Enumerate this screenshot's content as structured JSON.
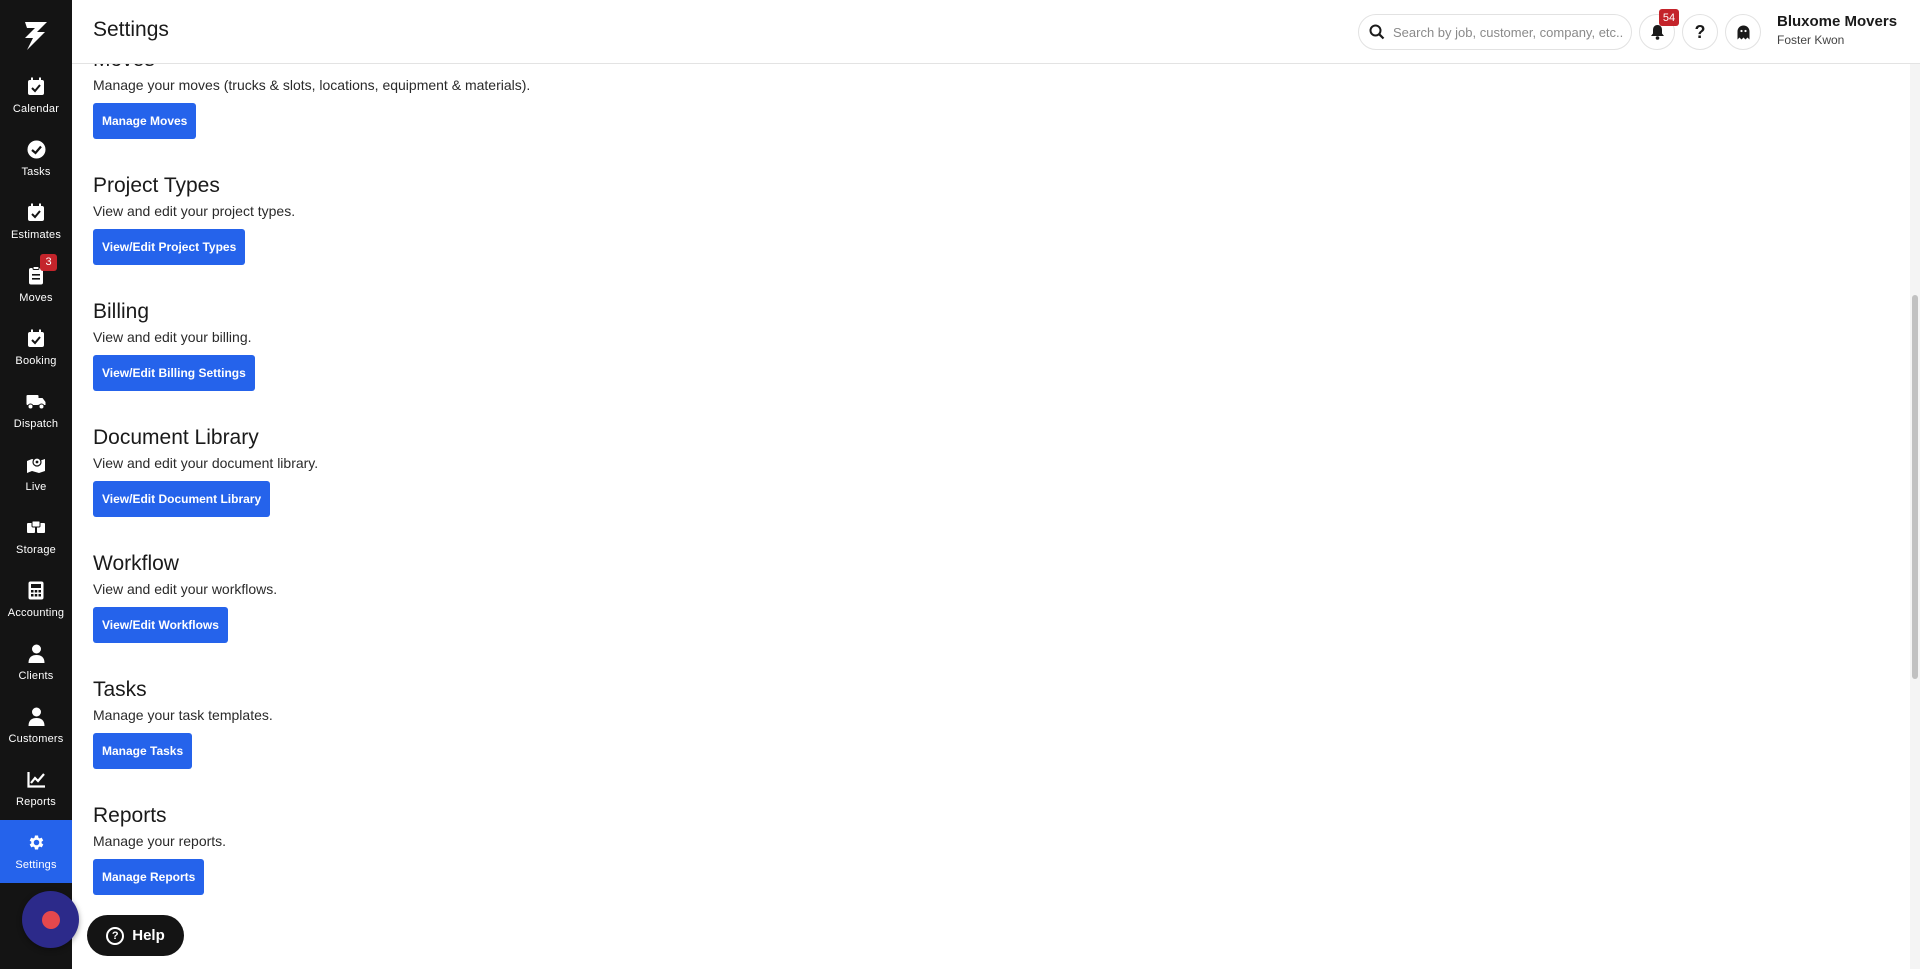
{
  "header": {
    "title": "Settings",
    "search_placeholder": "Search by job, customer, company, etc...",
    "notification_count": "54",
    "help_glyph": "?",
    "company_name": "Bluxome Movers",
    "user_name": "Foster Kwon"
  },
  "sidebar": {
    "items": [
      {
        "label": "Calendar",
        "icon": "calendar-check-icon"
      },
      {
        "label": "Tasks",
        "icon": "check-circle-icon"
      },
      {
        "label": "Estimates",
        "icon": "calendar-check-icon"
      },
      {
        "label": "Moves",
        "icon": "clipboard-icon",
        "badge": "3"
      },
      {
        "label": "Booking",
        "icon": "calendar-check-icon"
      },
      {
        "label": "Dispatch",
        "icon": "truck-icon"
      },
      {
        "label": "Live",
        "icon": "map-icon"
      },
      {
        "label": "Storage",
        "icon": "boxes-icon"
      },
      {
        "label": "Accounting",
        "icon": "calculator-icon"
      },
      {
        "label": "Clients",
        "icon": "user-icon"
      },
      {
        "label": "Customers",
        "icon": "user-icon"
      },
      {
        "label": "Reports",
        "icon": "chart-line-icon"
      },
      {
        "label": "Settings",
        "icon": "gear-icon",
        "active": true
      }
    ]
  },
  "sections": [
    {
      "title": "Moves",
      "description": "Manage your moves (trucks & slots, locations, equipment & materials).",
      "button": "Manage Moves"
    },
    {
      "title": "Project Types",
      "description": "View and edit your project types.",
      "button": "View/Edit Project Types"
    },
    {
      "title": "Billing",
      "description": "View and edit your billing.",
      "button": "View/Edit Billing Settings"
    },
    {
      "title": "Document Library",
      "description": "View and edit your document library.",
      "button": "View/Edit Document Library"
    },
    {
      "title": "Workflow",
      "description": "View and edit your workflows.",
      "button": "View/Edit Workflows"
    },
    {
      "title": "Tasks",
      "description": "Manage your task templates.",
      "button": "Manage Tasks"
    },
    {
      "title": "Reports",
      "description": "Manage your reports.",
      "button": "Manage Reports"
    }
  ],
  "floating": {
    "help_label": "Help",
    "help_glyph": "?"
  },
  "colors": {
    "accent": "#2563eb",
    "sidebar_bg": "#141414",
    "badge": "#c4242b"
  }
}
